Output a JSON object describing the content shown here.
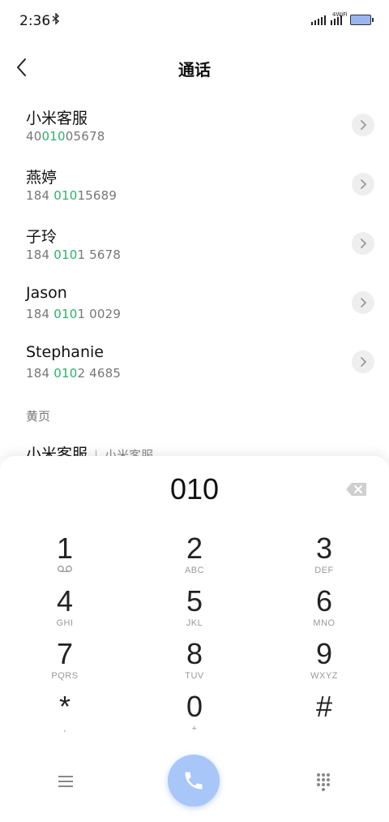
{
  "status_bar": {
    "time": "2:36",
    "network_label": "4WiFi"
  },
  "header": {
    "title": "通话"
  },
  "contacts": [
    {
      "name": "小米客服",
      "number_parts": [
        "40",
        "010",
        "05678"
      ]
    },
    {
      "name": "燕婷",
      "number_parts": [
        "184 ",
        "010",
        "15689"
      ]
    },
    {
      "name": "子玲",
      "number_parts": [
        "184 ",
        "010",
        "1 5678"
      ]
    },
    {
      "name": "Jason",
      "number_parts": [
        "184 ",
        "010",
        "1 0029"
      ]
    },
    {
      "name": "Stephanie",
      "number_parts": [
        "184 ",
        "010",
        "2 4685"
      ]
    }
  ],
  "yellow_pages": {
    "label": "黄页",
    "item_name": "小米客服",
    "item_sub": "小米客服"
  },
  "dialer": {
    "display": "010",
    "keys": [
      {
        "digit": "1",
        "letters": ""
      },
      {
        "digit": "2",
        "letters": "ABC"
      },
      {
        "digit": "3",
        "letters": "DEF"
      },
      {
        "digit": "4",
        "letters": "GHI"
      },
      {
        "digit": "5",
        "letters": "JKL"
      },
      {
        "digit": "6",
        "letters": "MNO"
      },
      {
        "digit": "7",
        "letters": "PQRS"
      },
      {
        "digit": "8",
        "letters": "TUV"
      },
      {
        "digit": "9",
        "letters": "WXYZ"
      },
      {
        "digit": "*",
        "letters": ","
      },
      {
        "digit": "0",
        "letters": "+"
      },
      {
        "digit": "#",
        "letters": ""
      }
    ]
  },
  "colors": {
    "highlight": "#2ab36a",
    "call_button": "#a8c6f8"
  },
  "icons": [
    "back-icon",
    "chevron-right-icon",
    "backspace-icon",
    "voicemail-icon",
    "menu-icon",
    "phone-icon",
    "dialpad-grid-icon",
    "bluetooth-icon",
    "battery-icon"
  ]
}
